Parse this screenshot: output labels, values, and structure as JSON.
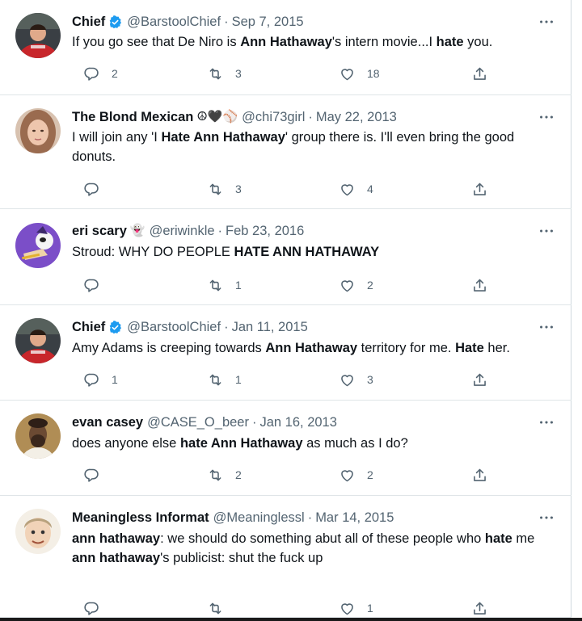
{
  "tweets": [
    {
      "name": "Chief",
      "verified": true,
      "handle": "@BarstoolChief",
      "date": "Sep 7, 2015",
      "avatar": "man-red-shirt",
      "lines": [
        [
          {
            "t": "If you go see that De Niro is "
          },
          {
            "t": "Ann Hathaway",
            "b": true
          },
          {
            "t": "'s intern movie...I "
          },
          {
            "t": "hate",
            "b": true
          },
          {
            "t": " you."
          }
        ]
      ],
      "replies": "2",
      "retweets": "3",
      "likes": "18"
    },
    {
      "name": "The Blond Mexican",
      "emojis": "☮🖤⚾",
      "handle": "@chi73girl",
      "date": "May 22, 2013",
      "avatar": "woman-blonde",
      "lines": [
        [
          {
            "t": "I will join any 'I "
          },
          {
            "t": "Hate Ann Hathaway",
            "b": true
          },
          {
            "t": "' group there is. I'll even bring the good donuts."
          }
        ]
      ],
      "replies": "",
      "retweets": "3",
      "likes": "4"
    },
    {
      "name": "eri scary",
      "emojis": "👻",
      "handle": "@eriwinkle",
      "date": "Feb 23, 2016",
      "avatar": "purple-cartoon",
      "lines": [
        [
          {
            "t": "Stroud: WHY DO PEOPLE "
          },
          {
            "t": "HATE ANN HATHAWAY",
            "b": true
          }
        ]
      ],
      "replies": "",
      "retweets": "1",
      "likes": "2"
    },
    {
      "name": "Chief",
      "verified": true,
      "handle": "@BarstoolChief",
      "date": "Jan 11, 2015",
      "avatar": "man-red-shirt",
      "lines": [
        [
          {
            "t": "Amy Adams is creeping towards "
          },
          {
            "t": "Ann Hathaway",
            "b": true
          },
          {
            "t": " territory for me. "
          },
          {
            "t": "Hate",
            "b": true
          },
          {
            "t": " her."
          }
        ]
      ],
      "replies": "1",
      "retweets": "1",
      "likes": "3"
    },
    {
      "name": "evan casey",
      "handle": "@CASE_O_beer",
      "date": "Jan 16, 2013",
      "avatar": "bearded-man",
      "lines": [
        [
          {
            "t": "does anyone else "
          },
          {
            "t": "hate Ann Hathaway",
            "b": true
          },
          {
            "t": " as much as I do?"
          }
        ]
      ],
      "replies": "",
      "retweets": "2",
      "likes": "2"
    },
    {
      "name": "Meaningless Informat",
      "handle": "@Meaninglessl",
      "date": "Mar 14, 2015",
      "avatar": "cartoon-face",
      "lines": [
        [
          {
            "t": "ann hathaway",
            "b": true
          },
          {
            "t": ": we should do something abut all of these people who "
          },
          {
            "t": "hate",
            "b": true
          },
          {
            "t": " me"
          }
        ],
        [
          {
            "t": "ann hathaway",
            "b": true
          },
          {
            "t": "'s publicist: shut the fuck up"
          }
        ]
      ],
      "replies": "",
      "retweets": "",
      "likes": "1"
    }
  ],
  "colors": {
    "text": "#0f1419",
    "secondary": "#536471",
    "verified": "#1d9bf0",
    "divider": "#dfe5e8"
  }
}
